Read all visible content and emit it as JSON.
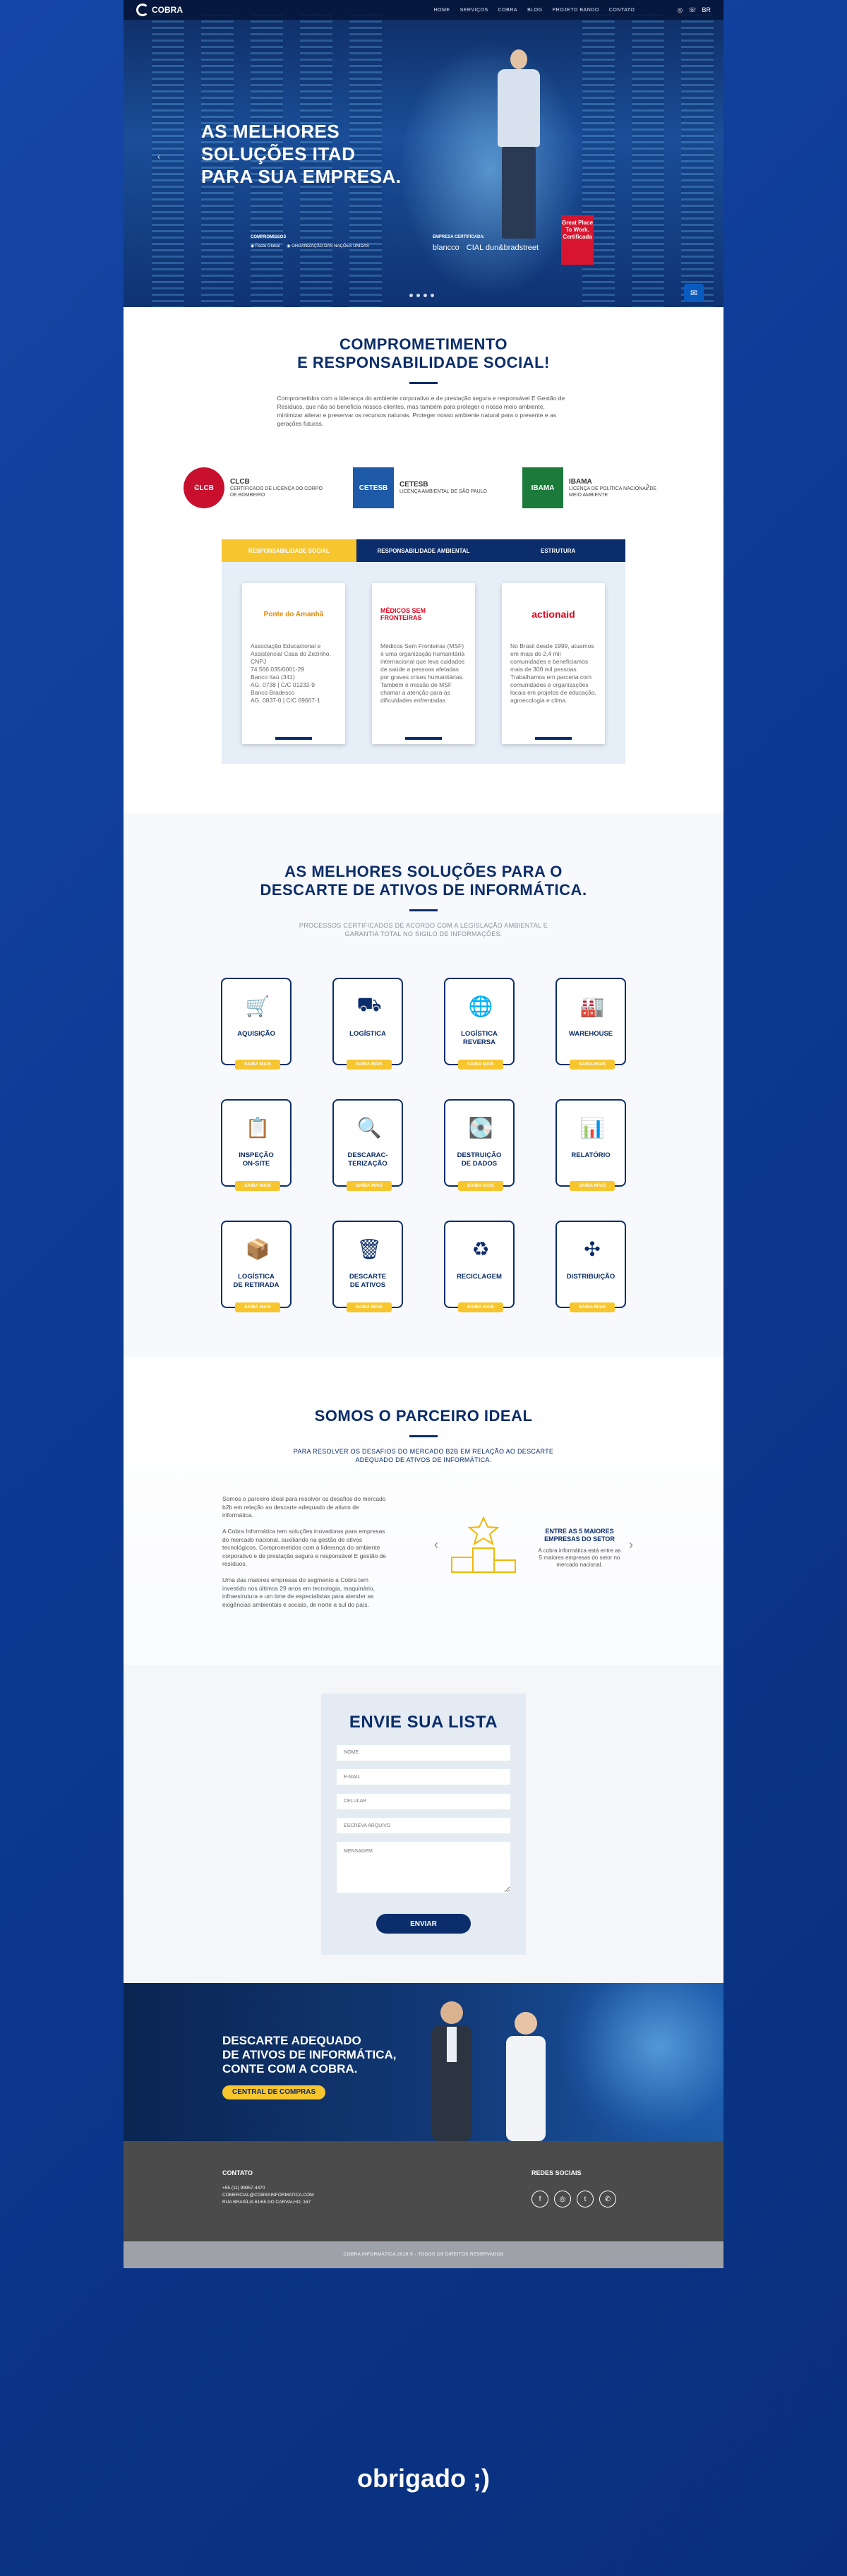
{
  "nav": {
    "brand": "COBRA",
    "links": [
      "HOME",
      "SERVIÇOS",
      "COBRA",
      "BLOG",
      "PROJETO BANDO",
      "CONTATO"
    ],
    "lang": "BR"
  },
  "hero": {
    "headline_1": "AS MELHORES",
    "headline_2": "SOLUÇÕES ITAD",
    "headline_3": "PARA SUA EMPRESA.",
    "partners_label": "COMPROMISSOS",
    "partners": [
      "Pacto Global",
      "ORGANIZAÇÃO DAS NAÇÕES UNIDAS"
    ],
    "certified_label": "EMPRESA CERTIFICADA:",
    "certifiers": [
      "blancco",
      "CIAL dun&bradstreet"
    ],
    "gptw": "Great Place To Work. Certificada"
  },
  "commitment": {
    "title_1": "COMPROMETIMENTO",
    "title_2": "E RESPONSABILIDADE SOCIAL!",
    "text": "Comprometidos com a liderança do ambiente corporativo e de prestação segura e responsável E Gestão de Resíduos, que não só beneficia nossos clientes, mas também para proteger o nosso meio ambiente, minimizar alterar e preservar os recursos naturais. Proteger nosso ambiente natural para o presente e as gerações futuras.",
    "certs": [
      {
        "name": "CLCB",
        "desc": "CERTIFICADO DE LICENÇA DO CORPO DE BOMBEIRO",
        "logo": "CLCB",
        "color": "#c8102e"
      },
      {
        "name": "CETESB",
        "desc": "LICENÇA AMBIENTAL DE SÃO PAULO",
        "logo": "CETESB",
        "color": "#1e5aa8"
      },
      {
        "name": "IBAMA",
        "desc": "LICENÇA DE POLÍTICA NACIONAL DE MEIO AMBIENTE",
        "logo": "IBAMA",
        "color": "#1c7a3a"
      }
    ],
    "tabs": [
      "RESPONSABILIDADE SOCIAL",
      "RESPONSABILIDADE AMBIENTAL",
      "ESTRUTURA"
    ],
    "cards": [
      {
        "logo": "Ponte do Amanhã",
        "text": "Associação Educacional e Assistencial Casa do Zezinho.\nCNPJ\n74.566.035/0001-29\nBanco Itaú (341)\nAG. 0738 | C/C 01232-9\nBanco Bradesco\nAG. 0837-0 | C/C 69667-1"
      },
      {
        "logo": "MÉDICOS SEM FRONTEIRAS",
        "text": "Médicos Sem Fronteiras (MSF) é uma organização humanitária internacional que leva cuidados de saúde a pessoas afetadas por graves crises humanitárias. Também é missão de MSF chamar a atenção para as dificuldades enfrentadas"
      },
      {
        "logo": "actionaid",
        "text": "No Brasil desde 1999, atuamos em mais de 2.4 mil comunidades e beneficiamos mais de 300 mil pessoas. Trabalhamos em parceria com comunidades e organizações locais em projetos de educação, agroecologia e clima."
      }
    ]
  },
  "solutions": {
    "title_1": "AS MELHORES SOLUÇÕES PARA O",
    "title_2": "DESCARTE DE ATIVOS DE INFORMÁTICA.",
    "sub_1": "PROCESSOS CERTIFICADOS DE ACORDO COM A LEGISLAÇÃO AMBIENTAL E",
    "sub_2": "GARANTIA TOTAL NO SIGILO DE INFORMAÇÕES.",
    "more": "SAIBA MAIS",
    "items": [
      {
        "label": "AQUISIÇÃO",
        "icon": "cart-icon",
        "glyph": "🛒"
      },
      {
        "label": "LOGÍSTICA",
        "icon": "hand-truck-icon",
        "glyph": "⛟"
      },
      {
        "label": "LOGÍSTICA\nREVERSA",
        "icon": "globe-icon",
        "glyph": "🌐"
      },
      {
        "label": "WAREHOUSE",
        "icon": "warehouse-icon",
        "glyph": "🏭"
      },
      {
        "label": "INSPEÇÃO\nON-SITE",
        "icon": "clipboard-check-icon",
        "glyph": "📋"
      },
      {
        "label": "DESCARAC-\nTERIZAÇÃO",
        "icon": "search-chart-icon",
        "glyph": "🔍"
      },
      {
        "label": "DESTRUIÇÃO\nDE DADOS",
        "icon": "hard-drive-icon",
        "glyph": "💽"
      },
      {
        "label": "RELATÓRIO",
        "icon": "report-icon",
        "glyph": "📊"
      },
      {
        "label": "LOGÍSTICA\nDE RETIRADA",
        "icon": "box-pin-icon",
        "glyph": "📦"
      },
      {
        "label": "DESCARTE\nDE ATIVOS",
        "icon": "trash-icon",
        "glyph": "🗑"
      },
      {
        "label": "RECICLAGEM",
        "icon": "recycle-icon",
        "glyph": "♻"
      },
      {
        "label": "DISTRIBUIÇÃO",
        "icon": "distribution-icon",
        "glyph": "✣"
      }
    ]
  },
  "partner": {
    "title": "SOMOS O PARCEIRO IDEAL",
    "sub_1": "PARA RESOLVER OS DESAFIOS DO MERCADO B2B EM RELAÇÃO AO DESCARTE",
    "sub_2": "ADEQUADO DE ATIVOS DE INFORMÁTICA.",
    "text": "Somos o parceiro ideal para resolver os desafios do mercado b2b em relação ao descarte adequado de ativos de informática.\n\nA Cobra Informática tem soluções inovadoras para empresas do mercado nacional, auxiliando na gestão de ativos tecnológicos. Comprometidos com a liderança do ambiente corporativo e de prestação segura e responsável E gestão de resíduos.\n\nUma das maiores empresas do segmento a Cobra tem investido nos últimos 29 anos em tecnologia, maquinário, infraestrutura e um time de especialistas para atender as exigências ambientais e sociais, de norte a sul do país.",
    "highlight_title": "ENTRE AS 5 MAIORES EMPRESAS DO SETOR",
    "highlight_text": "A cobra informática está entre as 5 maiores empresas do setor no mercado nacional."
  },
  "form": {
    "title": "ENVIE SUA LISTA",
    "name": "NOME",
    "email": "E-MAIL",
    "phone": "CELULAR",
    "company": "ESCREVA ARQUIVO",
    "message": "MENSAGEM",
    "submit": "ENVIAR"
  },
  "banner": {
    "text": "DESCARTE ADEQUADO\nDE ATIVOS DE INFORMÁTICA,\nCONTE COM A COBRA.",
    "button": "CENTRAL DE COMPRAS"
  },
  "footer": {
    "contact_title": "CONTATO",
    "contact_text": "+55 (11) 99957-4470\nCOMERCIAL@COBRAINFORMATICA.COM\nRUA BRASÍLIA 61/65 DO CARVALHO, 167",
    "social_title": "REDES SOCIAIS",
    "copyright": "COBRA INFORMÁTICA 2019 © - TODOS OS DIREITOS RESERVADOS"
  },
  "thanks": "obrigado ;)"
}
